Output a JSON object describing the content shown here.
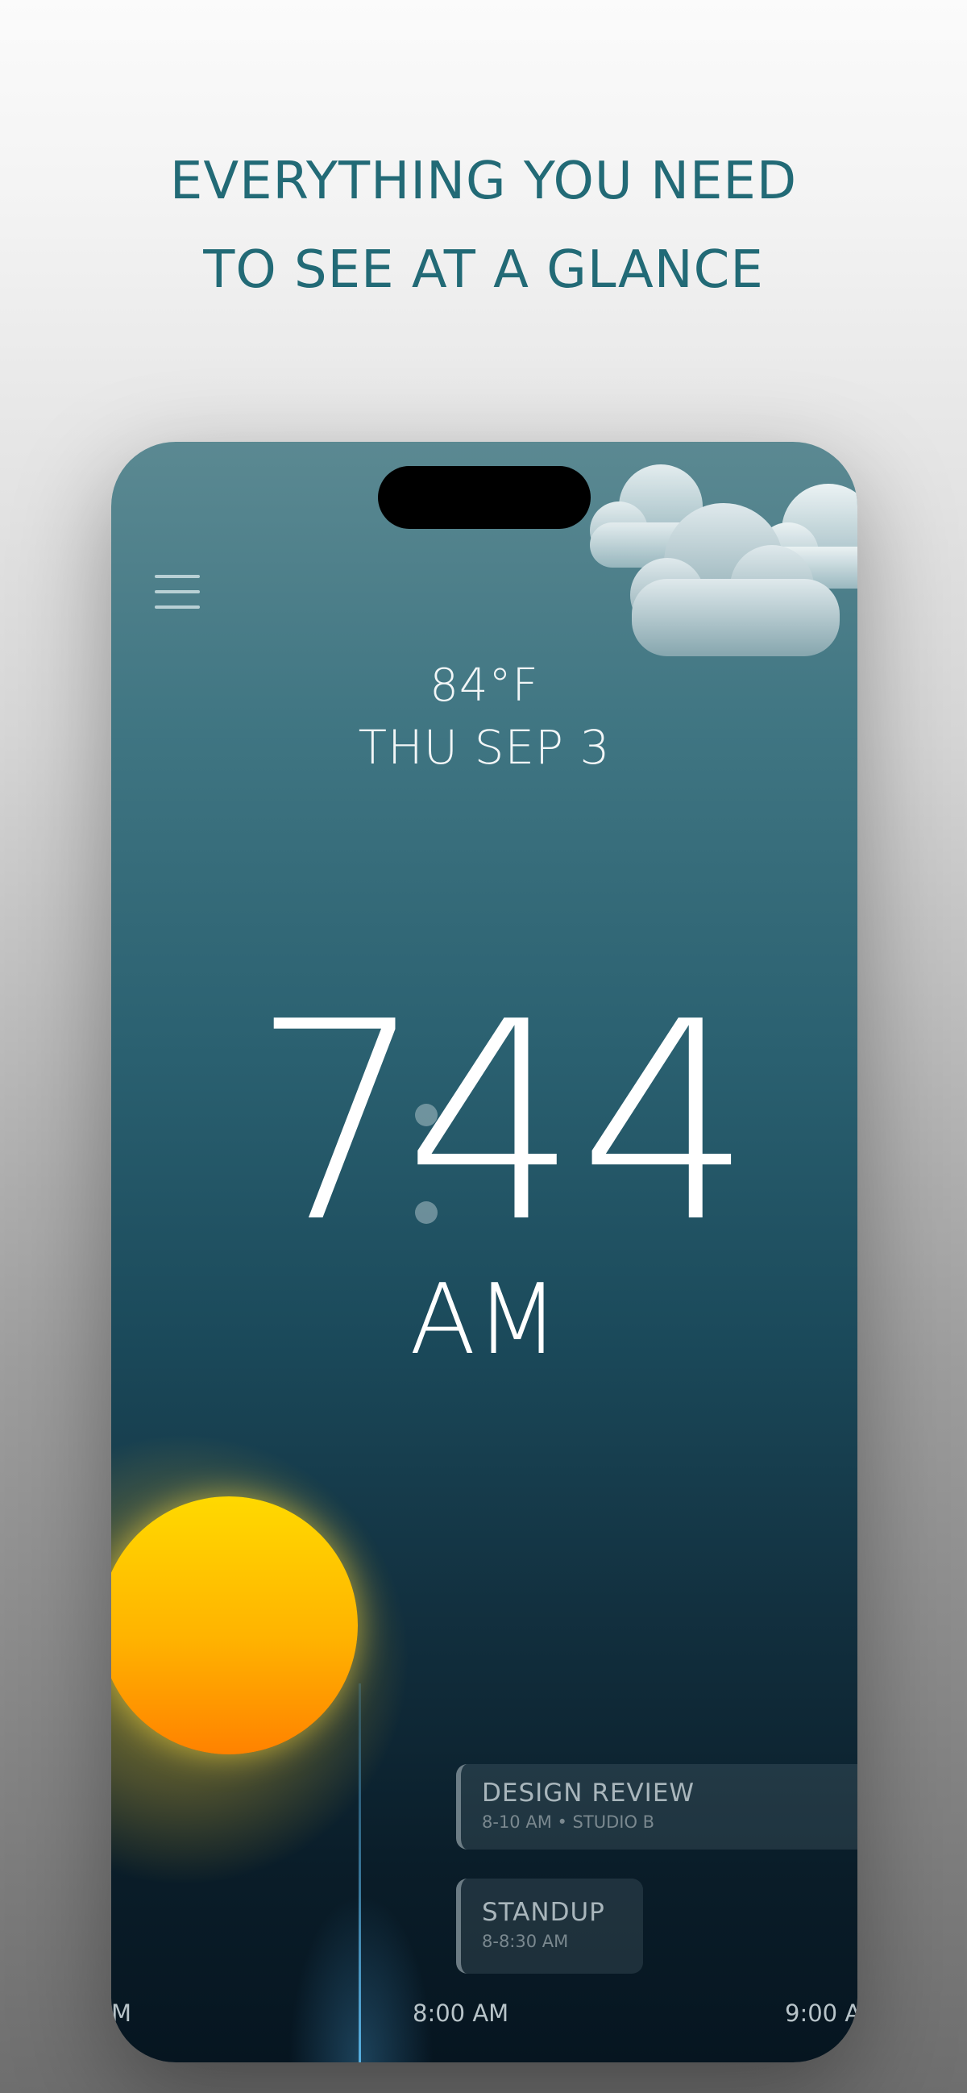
{
  "headline": {
    "line1": "EVERYTHING YOU NEED",
    "line2": "TO SEE AT A GLANCE"
  },
  "weather": {
    "temperature": "84°F",
    "date": "THU SEP 3",
    "condition_icon": "clouds-icon"
  },
  "clock": {
    "hour": "7",
    "minutes": "44",
    "period": "AM"
  },
  "menu": {
    "icon": "hamburger-menu-icon"
  },
  "events": [
    {
      "title": "DESIGN REVIEW",
      "detail": "8-10 AM • STUDIO B"
    },
    {
      "title": "STANDUP",
      "detail": "8-8:30 AM"
    }
  ],
  "timeline": {
    "left_label": "M",
    "mid_label": "8:00 AM",
    "right_label": "9:00 A"
  },
  "colors": {
    "headline": "#226a76",
    "sun_top": "#ffd900",
    "sun_bottom": "#ff8200",
    "now_line": "#5ab4e6"
  }
}
